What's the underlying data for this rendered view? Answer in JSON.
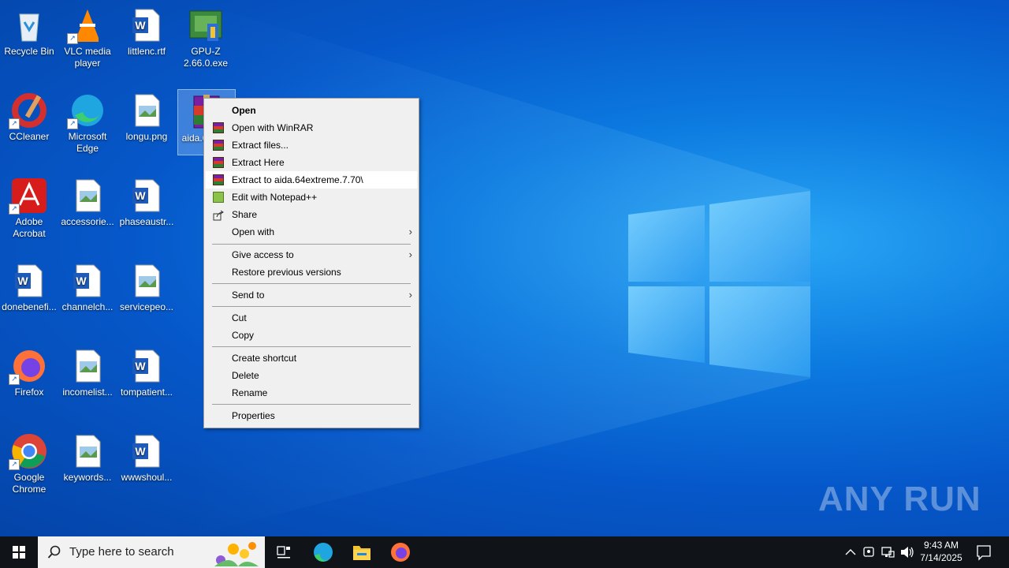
{
  "desktop": {
    "icons": [
      {
        "label": "Recycle Bin"
      },
      {
        "label": "VLC media player"
      },
      {
        "label": "littlenc.rtf"
      },
      {
        "label": "GPU-Z 2.66.0.exe"
      },
      {
        "label": "CCleaner"
      },
      {
        "label": "Microsoft Edge"
      },
      {
        "label": "longu.png"
      },
      {
        "label": "aida.64extreme.7.70",
        "selected": true,
        "visible_label": "aida.6 me.7"
      },
      {
        "label": "Adobe Acrobat"
      },
      {
        "label": "accessorie..."
      },
      {
        "label": "phaseaustr..."
      },
      {
        "label": "donebenefi..."
      },
      {
        "label": "channelch..."
      },
      {
        "label": "servicepeo..."
      },
      {
        "label": "Firefox"
      },
      {
        "label": "incomelist..."
      },
      {
        "label": "tompatient..."
      },
      {
        "label": "Google Chrome"
      },
      {
        "label": "keywords..."
      },
      {
        "label": "wwwshoul..."
      }
    ]
  },
  "context_menu": {
    "items": [
      {
        "label": "Open",
        "bold": true
      },
      {
        "label": "Open with WinRAR",
        "icon": "winrar-icon"
      },
      {
        "label": "Extract files...",
        "icon": "winrar-icon"
      },
      {
        "label": "Extract Here",
        "icon": "winrar-icon"
      },
      {
        "label": "Extract to aida.64extreme.7.70\\",
        "icon": "winrar-icon",
        "highlighted": true
      },
      {
        "label": "Edit with Notepad++",
        "icon": "notepadpp-icon"
      },
      {
        "label": "Share",
        "icon": "share-icon"
      },
      {
        "label": "Open with",
        "submenu": true
      },
      {
        "label": "Give access to",
        "submenu": true
      },
      {
        "label": "Restore previous versions"
      },
      {
        "label": "Send to",
        "submenu": true
      },
      {
        "label": "Cut"
      },
      {
        "label": "Copy"
      },
      {
        "label": "Create shortcut"
      },
      {
        "label": "Delete"
      },
      {
        "label": "Rename"
      },
      {
        "label": "Properties"
      }
    ]
  },
  "taskbar": {
    "search_placeholder": "Type here to search",
    "pinned": [
      "task-view-icon",
      "edge-icon",
      "file-explorer-icon",
      "firefox-icon"
    ],
    "clock_time": "9:43 AM",
    "clock_date": "7/14/2025"
  },
  "watermark": "ANY RUN",
  "colors": {
    "accent": "#0a6fd6",
    "menu_bg": "#f0f0f0",
    "taskbar_bg": "#101418"
  }
}
